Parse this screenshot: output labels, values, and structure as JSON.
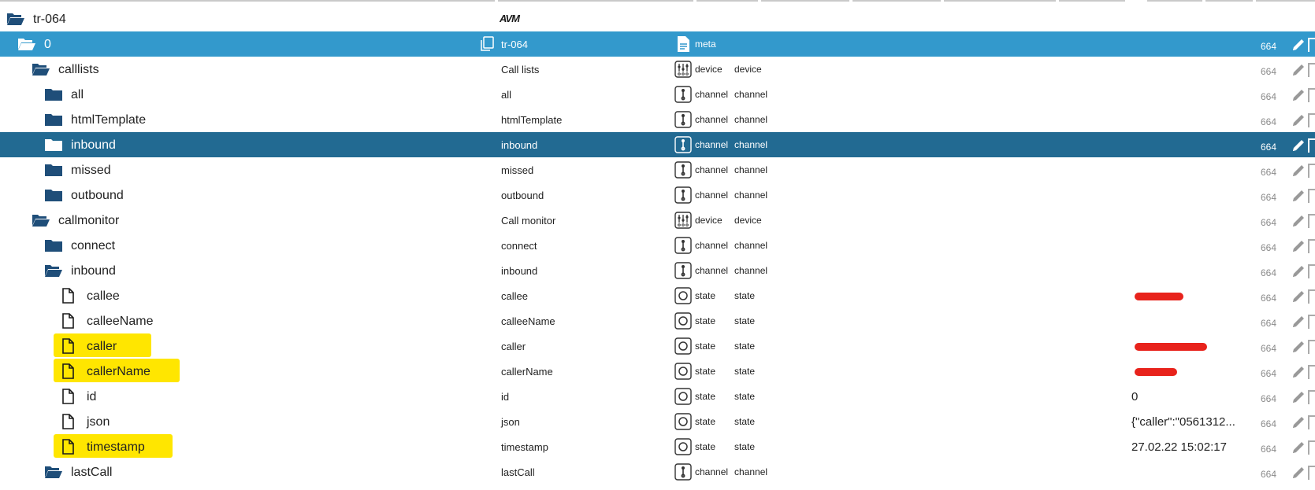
{
  "header": {
    "logo_text": "AVM"
  },
  "columns": {
    "acl_default": "664"
  },
  "rows": [
    {
      "name": "tr-064",
      "obj_name": "",
      "role": "",
      "type": "",
      "value": "",
      "acl": "",
      "kind": "folder-open",
      "depth": 0,
      "state": "normal",
      "icon": "avm-logo"
    },
    {
      "name": "0",
      "obj_name": "tr-064",
      "role": "meta",
      "type": "",
      "value": "",
      "acl": "664",
      "kind": "folder-open",
      "depth": 1,
      "state": "selected",
      "icon": "copy-icon",
      "role_icon": "meta-doc-icon"
    },
    {
      "name": "calllists",
      "obj_name": "Call lists",
      "role": "device",
      "type": "device",
      "value": "",
      "acl": "664",
      "kind": "folder-open",
      "depth": 2,
      "state": "normal",
      "role_icon": "device-icon"
    },
    {
      "name": "all",
      "obj_name": "all",
      "role": "channel",
      "type": "channel",
      "value": "",
      "acl": "664",
      "kind": "folder",
      "depth": 3,
      "state": "normal",
      "role_icon": "channel-icon"
    },
    {
      "name": "htmlTemplate",
      "obj_name": "htmlTemplate",
      "role": "channel",
      "type": "channel",
      "value": "",
      "acl": "664",
      "kind": "folder",
      "depth": 3,
      "state": "normal",
      "role_icon": "channel-icon"
    },
    {
      "name": "inbound",
      "obj_name": "inbound",
      "role": "channel",
      "type": "channel",
      "value": "",
      "acl": "664",
      "kind": "folder",
      "depth": 3,
      "state": "active",
      "role_icon": "channel-icon"
    },
    {
      "name": "missed",
      "obj_name": "missed",
      "role": "channel",
      "type": "channel",
      "value": "",
      "acl": "664",
      "kind": "folder",
      "depth": 3,
      "state": "normal",
      "role_icon": "channel-icon"
    },
    {
      "name": "outbound",
      "obj_name": "outbound",
      "role": "channel",
      "type": "channel",
      "value": "",
      "acl": "664",
      "kind": "folder",
      "depth": 3,
      "state": "normal",
      "role_icon": "channel-icon"
    },
    {
      "name": "callmonitor",
      "obj_name": "Call monitor",
      "role": "device",
      "type": "device",
      "value": "",
      "acl": "664",
      "kind": "folder-open",
      "depth": 2,
      "state": "normal",
      "role_icon": "device-icon"
    },
    {
      "name": "connect",
      "obj_name": "connect",
      "role": "channel",
      "type": "channel",
      "value": "",
      "acl": "664",
      "kind": "folder",
      "depth": 3,
      "state": "normal",
      "role_icon": "channel-icon"
    },
    {
      "name": "inbound",
      "obj_name": "inbound",
      "role": "channel",
      "type": "channel",
      "value": "",
      "acl": "664",
      "kind": "folder-open",
      "depth": 3,
      "state": "normal",
      "role_icon": "channel-icon"
    },
    {
      "name": "callee",
      "obj_name": "callee",
      "role": "state",
      "type": "state",
      "value": "",
      "acl": "664",
      "kind": "file",
      "depth": 4,
      "state": "normal",
      "role_icon": "state-icon",
      "redacted": "short"
    },
    {
      "name": "calleeName",
      "obj_name": "calleeName",
      "role": "state",
      "type": "state",
      "value": "",
      "acl": "664",
      "kind": "file",
      "depth": 4,
      "state": "normal",
      "role_icon": "state-icon"
    },
    {
      "name": "caller",
      "obj_name": "caller",
      "role": "state",
      "type": "state",
      "value": "",
      "acl": "664",
      "kind": "file",
      "depth": 4,
      "state": "normal",
      "role_icon": "state-icon",
      "highlight": true,
      "redacted": "long"
    },
    {
      "name": "callerName",
      "obj_name": "callerName",
      "role": "state",
      "type": "state",
      "value": "",
      "acl": "664",
      "kind": "file",
      "depth": 4,
      "state": "normal",
      "role_icon": "state-icon",
      "highlight": true,
      "redacted": "mid"
    },
    {
      "name": "id",
      "obj_name": "id",
      "role": "state",
      "type": "state",
      "value": "0",
      "acl": "664",
      "kind": "file",
      "depth": 4,
      "state": "normal",
      "role_icon": "state-icon"
    },
    {
      "name": "json",
      "obj_name": "json",
      "role": "state",
      "type": "state",
      "value": "{\"caller\":\"0561312...",
      "acl": "664",
      "kind": "file",
      "depth": 4,
      "state": "normal",
      "role_icon": "state-icon"
    },
    {
      "name": "timestamp",
      "obj_name": "timestamp",
      "role": "state",
      "type": "state",
      "value": "27.02.22 15:02:17",
      "acl": "664",
      "kind": "file",
      "depth": 4,
      "state": "normal",
      "role_icon": "state-icon",
      "highlight": true
    },
    {
      "name": "lastCall",
      "obj_name": "lastCall",
      "role": "channel",
      "type": "channel",
      "value": "",
      "acl": "664",
      "kind": "folder-open",
      "depth": 3,
      "state": "normal",
      "role_icon": "channel-icon"
    }
  ],
  "colors": {
    "selected_row": "#3399cc",
    "active_row": "#226a92",
    "folder": "#1f4e79",
    "highlight": "#ffe600",
    "redaction": "#e8231c"
  }
}
